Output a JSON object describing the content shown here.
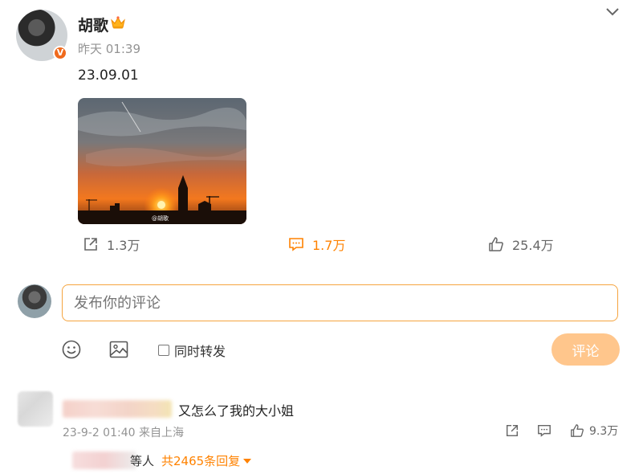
{
  "post": {
    "author": "胡歌",
    "verified_badge": "V",
    "time": "昨天 01:39",
    "text": "23.09.01",
    "image_watermark": "@胡歌",
    "actions": {
      "repost": "1.3万",
      "comment": "1.7万",
      "like": "25.4万"
    }
  },
  "composer": {
    "placeholder": "发布你的评论",
    "also_repost_label": "同时转发",
    "submit_label": "评论"
  },
  "comment": {
    "text": "又怎么了我的大小姐",
    "meta": "23-9-2 01:40 来自上海",
    "like_count": "9.3万",
    "reply_prefix_fragment": "等人",
    "reply_count_text": "共2465条回复"
  },
  "colors": {
    "accent": "#ff8200",
    "input_border": "#f5a43f",
    "submit_bg": "#ffc68c",
    "muted": "#939393"
  },
  "icons": [
    "crown-icon",
    "chevron-down-icon",
    "repost-icon",
    "comment-icon",
    "like-icon",
    "emoji-icon",
    "image-icon",
    "caret-down-icon"
  ]
}
